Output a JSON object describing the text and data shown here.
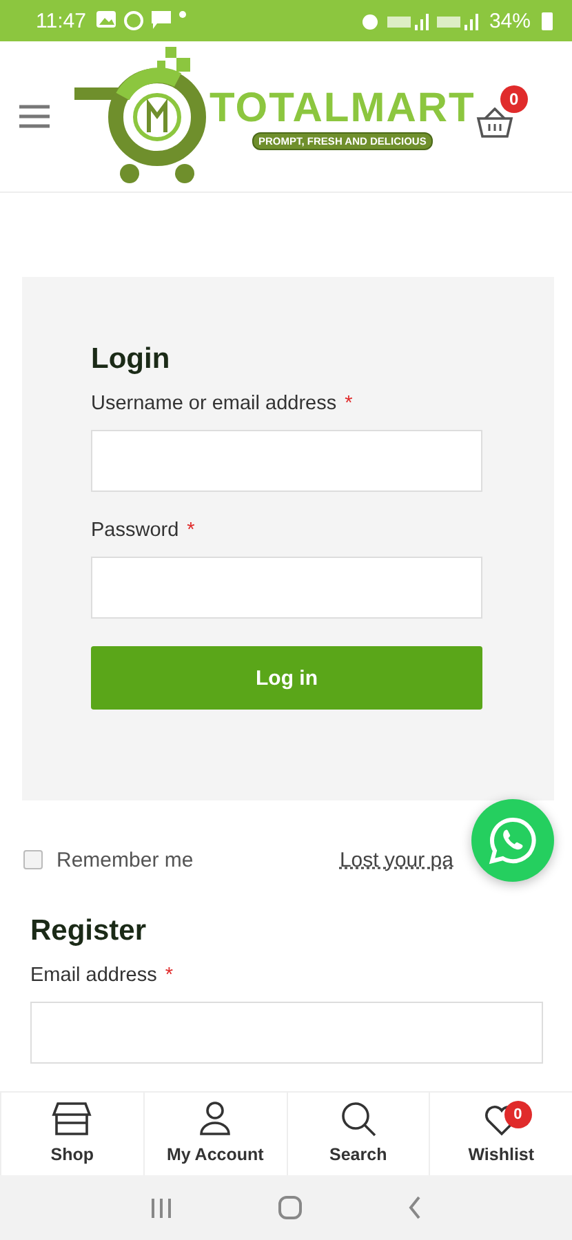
{
  "status_bar": {
    "time": "11:47",
    "battery": "34%"
  },
  "header": {
    "brand": "TOTALMART",
    "tagline": "PROMPT, FRESH AND DELICIOUS",
    "cart_count": "0"
  },
  "login": {
    "title": "Login",
    "fields": [
      {
        "label": "Username or email address",
        "required": "*"
      },
      {
        "label": "Password",
        "required": "*"
      }
    ],
    "button": "Log in"
  },
  "remember": {
    "label": "Remember me",
    "checked": false
  },
  "lost_password": "Lost your pa",
  "register": {
    "title": "Register",
    "fields": [
      {
        "label": "Email address",
        "required": "*"
      }
    ]
  },
  "bottom_nav": [
    {
      "kind": "shop",
      "label": "Shop"
    },
    {
      "kind": "account",
      "label": "My Account"
    },
    {
      "kind": "search",
      "label": "Search"
    },
    {
      "kind": "wishlist",
      "label": "Wishlist",
      "badge": "0"
    }
  ]
}
